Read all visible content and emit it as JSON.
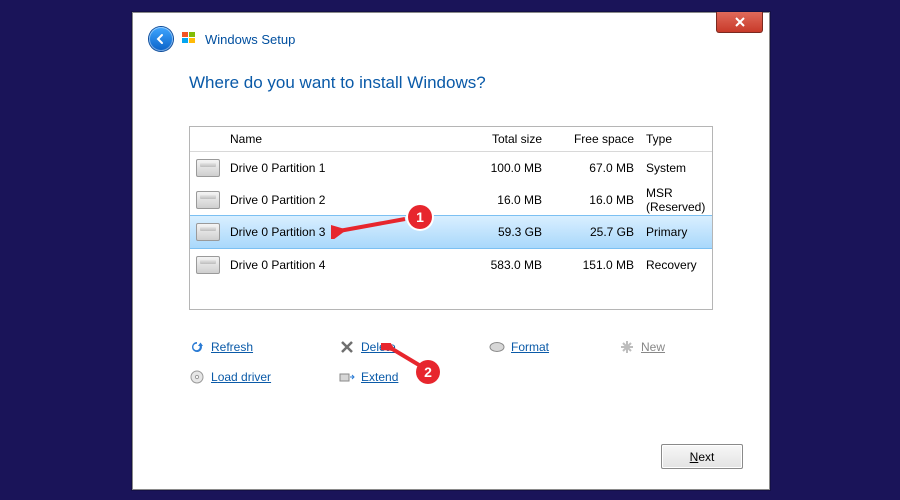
{
  "window": {
    "title": "Windows Setup"
  },
  "heading": "Where do you want to install Windows?",
  "columns": {
    "name": "Name",
    "total": "Total size",
    "free": "Free space",
    "type": "Type"
  },
  "rows": [
    {
      "name": "Drive 0 Partition 1",
      "total": "100.0 MB",
      "free": "67.0 MB",
      "type": "System",
      "selected": false
    },
    {
      "name": "Drive 0 Partition 2",
      "total": "16.0 MB",
      "free": "16.0 MB",
      "type": "MSR (Reserved)",
      "selected": false
    },
    {
      "name": "Drive 0 Partition 3",
      "total": "59.3 GB",
      "free": "25.7 GB",
      "type": "Primary",
      "selected": true
    },
    {
      "name": "Drive 0 Partition 4",
      "total": "583.0 MB",
      "free": "151.0 MB",
      "type": "Recovery",
      "selected": false
    }
  ],
  "actions": {
    "refresh": "Refresh",
    "delete": "Delete",
    "format": "Format",
    "new": "New",
    "load_driver": "Load driver",
    "extend": "Extend"
  },
  "next_label": "Next",
  "annotations": {
    "a1": "1",
    "a2": "2"
  }
}
